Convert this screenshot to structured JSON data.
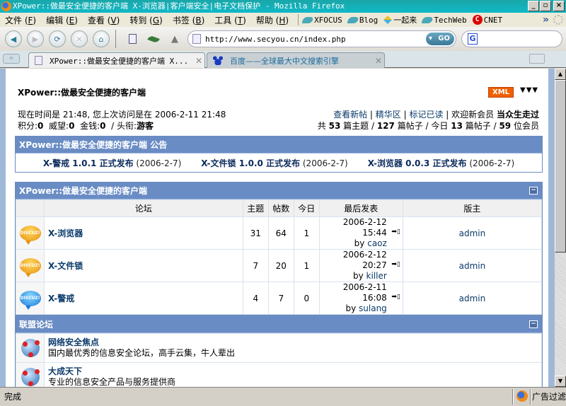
{
  "window": {
    "title": "XPower::做最安全便捷的客户端 X-浏览器|客户端安全|电子文档保护 - Mozilla Firefox",
    "buttons": {
      "minimize": "_",
      "maximize": "▫",
      "close": "×"
    }
  },
  "menubar": {
    "items": [
      {
        "label": "文件",
        "key": "F"
      },
      {
        "label": "编辑",
        "key": "E"
      },
      {
        "label": "查看",
        "key": "V"
      },
      {
        "label": "转到",
        "key": "G"
      },
      {
        "label": "书签",
        "key": "B"
      },
      {
        "label": "工具",
        "key": "T"
      },
      {
        "label": "帮助",
        "key": "H"
      }
    ],
    "bookmarks": [
      {
        "label": "XFOCUS",
        "icon": "bookmark-icon"
      },
      {
        "label": "Blog",
        "icon": "bookmark-icon"
      },
      {
        "label": "一起来",
        "icon": "yiqilai-icon"
      },
      {
        "label": "TechWeb",
        "icon": "bookmark-icon"
      },
      {
        "label": "CNET",
        "icon": "cnet-icon"
      }
    ],
    "more": "»"
  },
  "navbar": {
    "url": "http://www.secyou.cn/index.php",
    "go_label": "GO",
    "search_placeholder": ""
  },
  "tabs": [
    {
      "title": "XPower::做最安全便捷的客户端 X...",
      "active": true
    },
    {
      "title": "百度——全球最大中文搜索引擎",
      "active": false
    }
  ],
  "page": {
    "header_title": "XPower::做最安全便捷的客户端",
    "xml_badge": "XML",
    "info_left": {
      "line1": "现在时间是 21:48, 您上次访问是在 2006-2-11 21:48",
      "score_label": "积分:",
      "score": "0",
      "prestige_label": "威望:",
      "prestige": "0",
      "money_label": "金钱:",
      "money": "0",
      "title_label": "/ 头衔:",
      "title": "游客"
    },
    "info_right": {
      "links": [
        "查看新帖",
        "精华区",
        "标记已读"
      ],
      "welcome_label": "欢迎新会员",
      "new_member": "当众生走过",
      "stats": {
        "prefix": "共",
        "threads": "53",
        "threads_label": "篇主题 /",
        "posts": "127",
        "posts_label": "篇帖子 / 今日",
        "today": "13",
        "today_label": "篇帖子 /",
        "members": "59",
        "members_label": "位会员"
      }
    },
    "announcement": {
      "title": "XPower::做最安全便捷的客户端 公告",
      "items": [
        {
          "title": "X-警戒 1.0.1 正式发布",
          "date": "(2006-2-7)"
        },
        {
          "title": "X-文件锁 1.0.0 正式发布",
          "date": "(2006-2-7)"
        },
        {
          "title": "X-浏览器 0.0.3 正式发布",
          "date": "(2006-2-7)"
        }
      ]
    },
    "forum_section": {
      "title": "XPower::做最安全便捷的客户端",
      "columns": [
        "论坛",
        "主题",
        "帖数",
        "今日",
        "最后发表",
        "版主"
      ],
      "rows": [
        {
          "icon": "discuz-new",
          "name": "X-浏览器",
          "threads": "31",
          "posts": "64",
          "today": "1",
          "last_time": "2006-2-12 15:44",
          "last_by_label": "by",
          "last_user": "caoz",
          "moderator": "admin"
        },
        {
          "icon": "discuz-new",
          "name": "X-文件锁",
          "threads": "7",
          "posts": "20",
          "today": "1",
          "last_time": "2006-2-12 20:27",
          "last_by_label": "by",
          "last_user": "killer",
          "moderator": "admin"
        },
        {
          "icon": "discuz-old",
          "name": "X-警戒",
          "threads": "4",
          "posts": "7",
          "today": "0",
          "last_time": "2006-2-11 16:08",
          "last_by_label": "by",
          "last_user": "sulang",
          "moderator": "admin"
        }
      ]
    },
    "union_section": {
      "title": "联盟论坛",
      "rows": [
        {
          "name": "网络安全焦点",
          "desc": "国内最优秀的信息安全论坛，高手云集，牛人辈出"
        },
        {
          "name": "大成天下",
          "desc": "专业的信息安全产品与服务提供商"
        }
      ]
    }
  },
  "statusbar": {
    "text": "完成",
    "adblock": "广告过滤器"
  },
  "colors": {
    "header_blue": "#6a8cc4",
    "xml_orange": "#f06000",
    "link_navy": "#0a2a5a",
    "titlebar_teal": "#1aa6a8"
  }
}
